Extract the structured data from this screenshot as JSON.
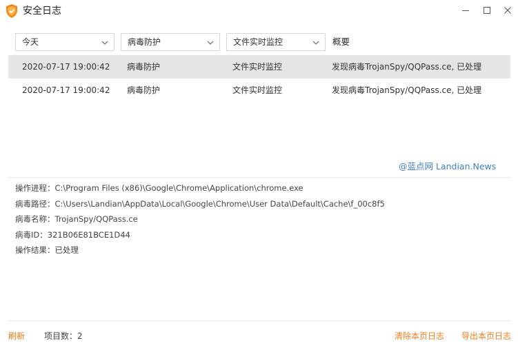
{
  "window": {
    "title": "安全日志"
  },
  "filters": {
    "date_selected": "今天",
    "category_selected": "病毒防护",
    "source_selected": "文件实时监控",
    "summary_header": "概要"
  },
  "rows": [
    {
      "time": "2020-07-17 19:00:42",
      "category": "病毒防护",
      "source": "文件实时监控",
      "summary": "发现病毒TrojanSpy/QQPass.ce, 已处理"
    },
    {
      "time": "2020-07-17 19:00:42",
      "category": "病毒防护",
      "source": "文件实时监控",
      "summary": "发现病毒TrojanSpy/QQPass.ce, 已处理"
    }
  ],
  "watermark": "@蓝点网 Landian.News",
  "details": {
    "process": "操作进程：C:\\Program Files (x86)\\Google\\Chrome\\Application\\chrome.exe",
    "path": "病毒路径：C:\\Users\\Landian\\AppData\\Local\\Google\\Chrome\\User Data\\Default\\Cache\\f_00c8f5",
    "name": "病毒名称：TrojanSpy/QQPass.ce",
    "id": "病毒ID：321B06E81BCE1D44",
    "result": "操作结果：已处理"
  },
  "footer": {
    "refresh": "刷新",
    "item_count": "项目数：2",
    "clear_page": "清除本页日志",
    "export_page": "导出本页日志"
  },
  "colors": {
    "accent": "#f07d18",
    "selected_row": "#e5e5e5",
    "watermark": "#3e7fc6"
  },
  "icons": [
    "shield-app-icon",
    "minimize-icon",
    "maximize-icon",
    "close-icon",
    "chevron-down-icon"
  ]
}
